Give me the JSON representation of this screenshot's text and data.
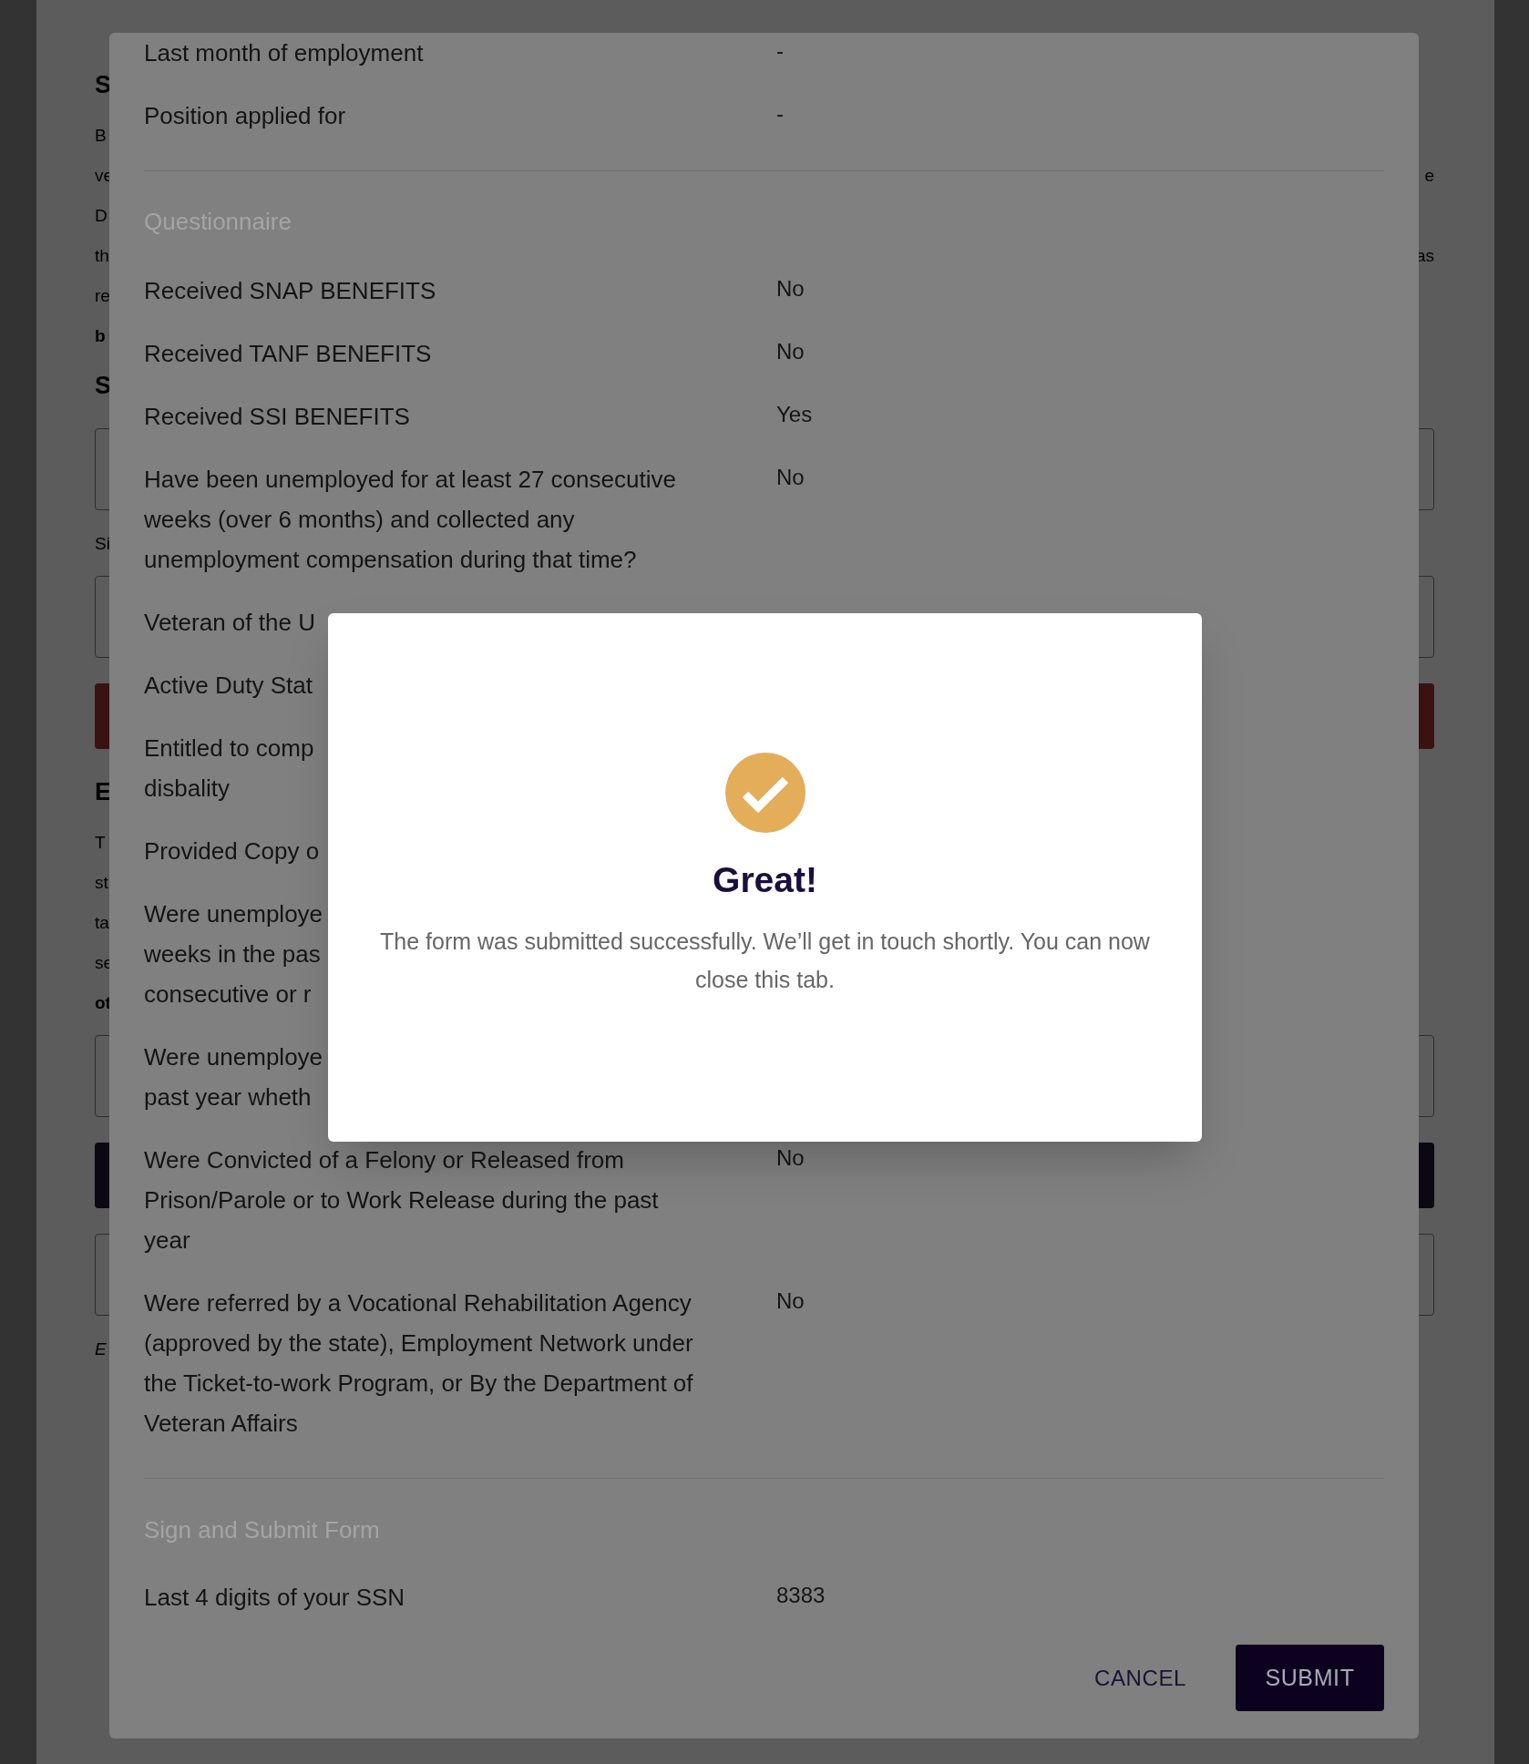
{
  "background_page": {
    "fragments": [
      {
        "kind": "heading",
        "left": "S"
      },
      {
        "kind": "text",
        "left": "B"
      },
      {
        "kind": "text",
        "left": "ve",
        "right": "e"
      },
      {
        "kind": "text",
        "left": "D"
      },
      {
        "kind": "text",
        "left": "th",
        "right": "as"
      },
      {
        "kind": "text",
        "left": "re"
      },
      {
        "kind": "bold",
        "left": "b"
      },
      {
        "kind": "heading",
        "left": "S"
      },
      {
        "kind": "box"
      },
      {
        "kind": "text",
        "left": "Si"
      },
      {
        "kind": "box"
      },
      {
        "kind": "red-button"
      },
      {
        "kind": "heading",
        "left": "E"
      },
      {
        "kind": "text",
        "left": "T"
      },
      {
        "kind": "text",
        "left": "st"
      },
      {
        "kind": "text",
        "left": "ta"
      },
      {
        "kind": "text",
        "left": "se"
      },
      {
        "kind": "bold",
        "left": "ot"
      },
      {
        "kind": "box"
      },
      {
        "kind": "dark-button"
      },
      {
        "kind": "box"
      },
      {
        "kind": "italic",
        "left": "E"
      }
    ]
  },
  "review_modal": {
    "details": [
      {
        "lines": [
          "Last month of employment"
        ],
        "value": "-"
      },
      {
        "lines": [
          "Position applied for"
        ],
        "value": "-"
      }
    ],
    "questionnaire_heading": "Questionnaire",
    "questions": [
      {
        "lines": [
          "Received SNAP BENEFITS"
        ],
        "value": "No"
      },
      {
        "lines": [
          "Received TANF BENEFITS"
        ],
        "value": "No"
      },
      {
        "lines": [
          "Received SSI BENEFITS"
        ],
        "value": "Yes"
      },
      {
        "lines": [
          "Have been unemployed for at least 27 consecutive",
          "weeks (over 6 months) and collected any",
          "unemployment compensation during that time?"
        ],
        "value": "No"
      },
      {
        "lines": [
          "Veteran of the U"
        ]
      },
      {
        "lines": [
          "Active Duty Stat"
        ]
      },
      {
        "lines": [
          "Entitled to comp",
          "disbality"
        ]
      },
      {
        "lines": [
          "Provided Copy o"
        ]
      },
      {
        "lines": [
          "Were unemploye",
          "weeks in the pas",
          "consecutive or r"
        ]
      },
      {
        "lines": [
          "Were unemploye",
          "past year wheth"
        ]
      },
      {
        "lines": [
          "Were Convicted of a Felony or Released from",
          "Prison/Parole or to Work Release during the past",
          "year"
        ],
        "value": "No"
      },
      {
        "lines": [
          "Were referred by a Vocational Rehabilitation Agency",
          "(approved by the state), Employment Network under",
          "the Ticket-to-work Program, or By the Department of",
          "Veteran Affairs"
        ],
        "value": "No"
      }
    ],
    "sign_heading": "Sign and Submit Form",
    "sign_rows": [
      {
        "lines": [
          "Last 4 digits of your SSN"
        ],
        "value": "8383"
      }
    ],
    "buttons": [
      {
        "kind": "text",
        "label": "CANCEL"
      },
      {
        "kind": "primary",
        "label": "SUBMIT"
      }
    ]
  },
  "success_dialog": {
    "title": "Great!",
    "message": "The form was submitted successfully. We’ll get in touch shortly. You can now close this tab."
  }
}
